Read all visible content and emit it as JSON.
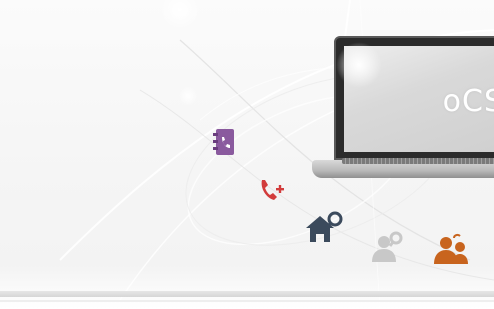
{
  "banner": {
    "screen_text": "oCS"
  },
  "icons": [
    {
      "name": "phonebook-icon",
      "color": "#8a5a9e"
    },
    {
      "name": "add-call-icon",
      "color": "#d23c3c"
    },
    {
      "name": "home-search-icon",
      "color": "#3b4a5c"
    },
    {
      "name": "user-search-icon",
      "color": "#c8c8c8"
    },
    {
      "name": "user-contact-icon",
      "color": "#c8641e"
    }
  ],
  "colors": {
    "background": "#f5f5f5",
    "screen_text": "#ffffff"
  }
}
